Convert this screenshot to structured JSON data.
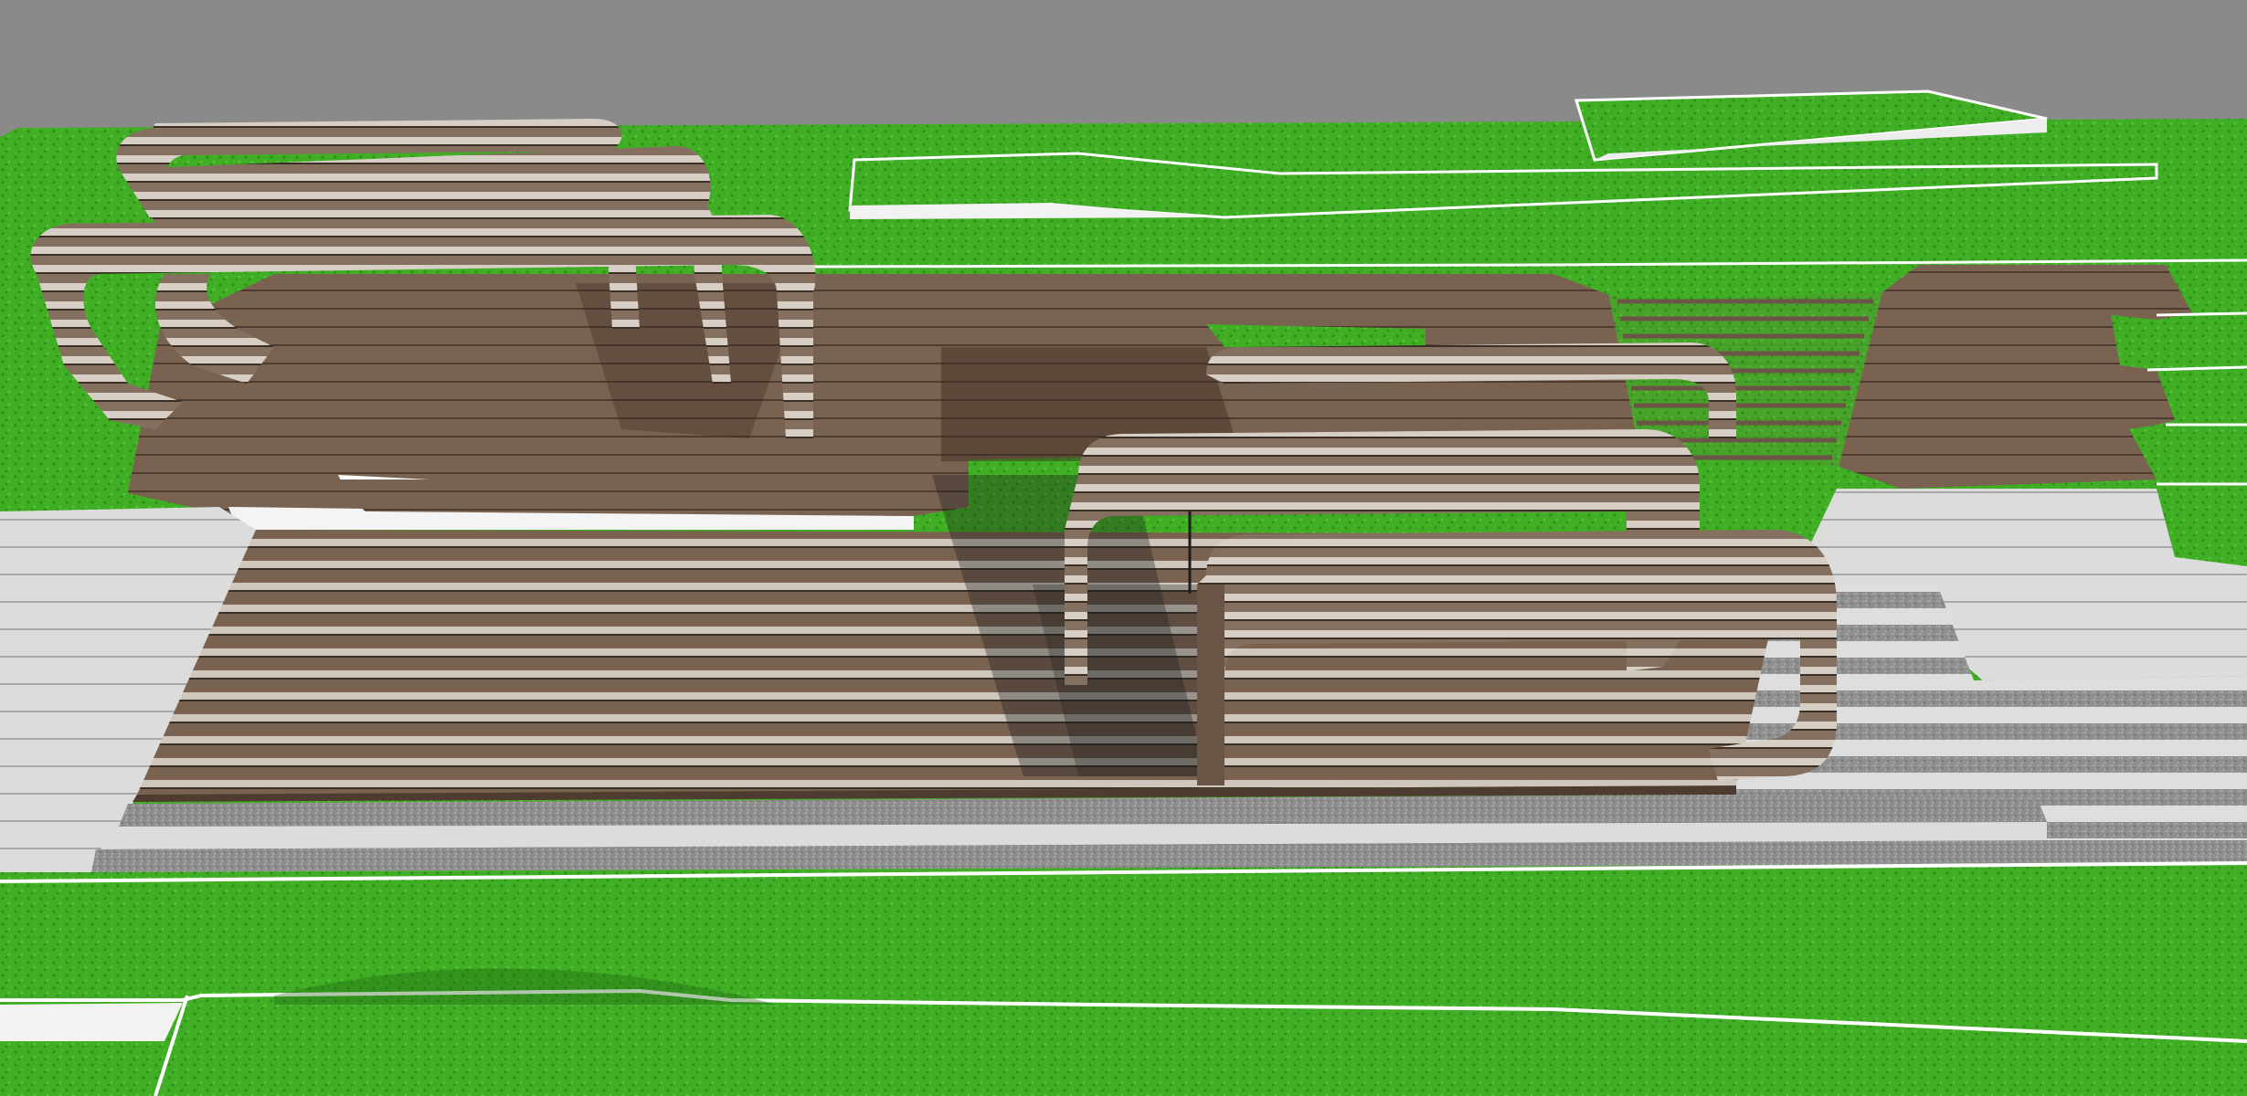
{
  "scene": {
    "description_visible_text": "",
    "colors": {
      "sky": "#8a8a8a",
      "grass": "#3fae24",
      "grass_dark": "#2f8f1a",
      "wood": "#7a6250",
      "wood_dark": "#4e3c30",
      "wood_light": "#c9bfb6",
      "concrete": "#d9d9d9",
      "concrete_line": "#a9a9a9",
      "gravel": "#8f8f8f",
      "edge": "#ffffff",
      "shadow": "#1e1e1e"
    }
  }
}
